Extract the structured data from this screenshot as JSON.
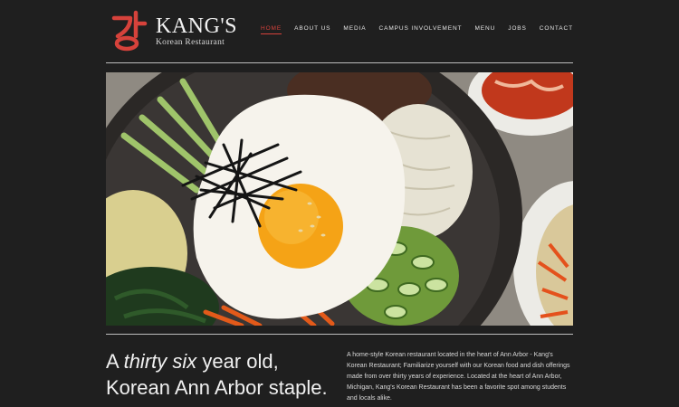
{
  "brand": {
    "name": "KANG'S",
    "subtitle": "Korean Restaurant",
    "mark": "강",
    "accent": "#d6423b"
  },
  "nav": {
    "items": [
      {
        "label": "HOME",
        "active": true
      },
      {
        "label": "ABOUT US",
        "active": false
      },
      {
        "label": "MEDIA",
        "active": false
      },
      {
        "label": "CAMPUS INVOLVEMENT",
        "active": false
      },
      {
        "label": "MENU",
        "active": false
      },
      {
        "label": "JOBS",
        "active": false
      },
      {
        "label": "CONTACT",
        "active": false
      }
    ]
  },
  "hero": {
    "image": "bibimbap-photo"
  },
  "intro": {
    "tagline_pre": "A ",
    "tagline_em": "thirty six",
    "tagline_post": " year old,",
    "tagline_line2": "Korean Ann Arbor staple.",
    "description": "A home-style Korean restaurant located in the heart of Ann Arbor - Kang's Korean Restaurant; Familiarize yourself with our Korean food and dish offerings made from over thirty years of experience. Located at the heart of Ann Arbor, Michigan, Kang's Korean Restaurant has been a favorite spot among students and locals alike."
  }
}
